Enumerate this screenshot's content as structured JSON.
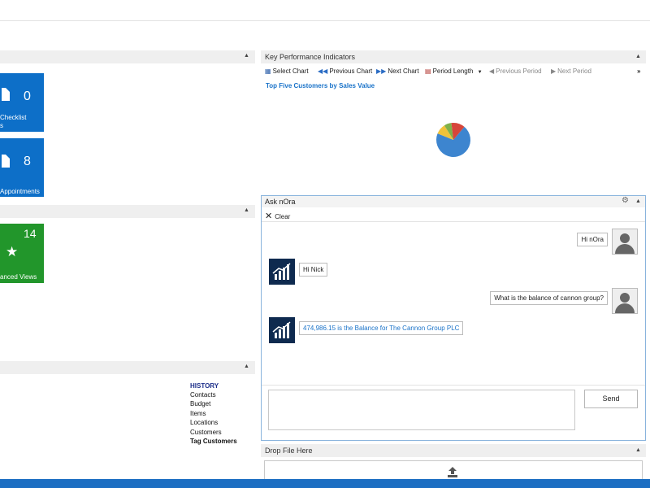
{
  "left_panel": {
    "tiles": [
      {
        "count": "0",
        "label": "Checklist\ns"
      },
      {
        "count": "8",
        "label": "Appointments"
      },
      {
        "count": "14",
        "label": "anced Views"
      }
    ],
    "history": {
      "heading": "HISTORY",
      "items": [
        "Contacts",
        "Budget",
        "Items",
        "Locations",
        "Customers",
        "Tag Customers"
      ]
    }
  },
  "kpi": {
    "title": "Key Performance Indicators",
    "toolbar": {
      "select_chart": "Select Chart",
      "previous_chart": "Previous Chart",
      "next_chart": "Next Chart",
      "period_length": "Period Length",
      "previous_period": "Previous Period",
      "next_period": "Next Period"
    },
    "chart_link": "Top Five Customers by Sales Value"
  },
  "chart_data": {
    "type": "pie",
    "title": "Top Five Customers by Sales Value",
    "slices": [
      {
        "value": 70,
        "color": "#3d85cf"
      },
      {
        "value": 10,
        "color": "#f0c23a"
      },
      {
        "value": 7,
        "color": "#7fb24a"
      },
      {
        "value": 13,
        "color": "#d6453a"
      }
    ]
  },
  "ask": {
    "title": "Ask nOra",
    "clear_label": "Clear",
    "messages": [
      {
        "from": "user",
        "text": "Hi nOra"
      },
      {
        "from": "bot",
        "text": "Hi Nick"
      },
      {
        "from": "user",
        "text": "What is the balance of cannon group?"
      },
      {
        "from": "bot",
        "text": "474,986.15 is the Balance for The Cannon Group PLC"
      }
    ],
    "input_value": "",
    "send_label": "Send"
  },
  "drop": {
    "title": "Drop File Here"
  },
  "colors": {
    "tile_blue": "#0d6fc8",
    "tile_green": "#22962b",
    "accent_link": "#1a73c9",
    "bot_bg": "#0e2a4f"
  }
}
